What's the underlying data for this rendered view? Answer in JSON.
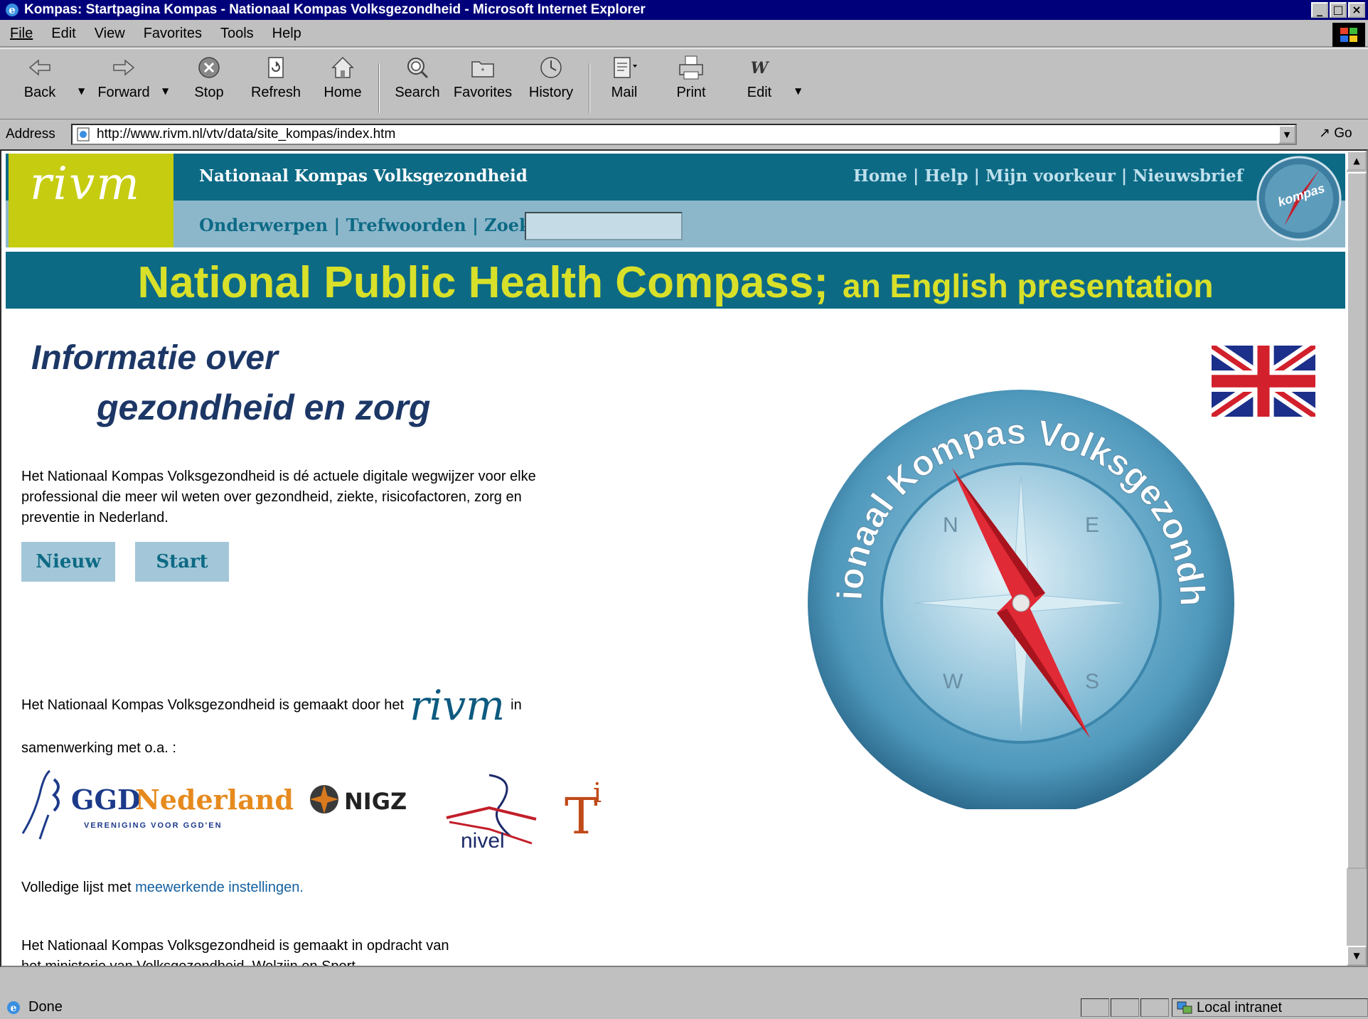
{
  "window": {
    "title": "Kompas: Startpagina Kompas - Nationaal Kompas Volksgezondheid - Microsoft Internet Explorer",
    "min": "_",
    "max": "□",
    "close": "×"
  },
  "menu": [
    "File",
    "Edit",
    "View",
    "Favorites",
    "Tools",
    "Help"
  ],
  "toolbar": {
    "back": "Back",
    "forward": "Forward",
    "stop": "Stop",
    "refresh": "Refresh",
    "home": "Home",
    "search": "Search",
    "favorites": "Favorites",
    "history": "History",
    "mail": "Mail",
    "print": "Print",
    "edit": "Edit"
  },
  "address": {
    "label": "Address",
    "url": "http://www.rivm.nl/vtv/data/site_kompas/index.htm",
    "go": "Go"
  },
  "site": {
    "logo": "rivm",
    "name": "Nationaal Kompas Volksgezondheid",
    "topnav": "Home | Help | Mijn voorkeur | Nieuwsbrief",
    "subnav": "Onderwerpen | Trefwoorden | Zoek :",
    "search_value": "",
    "kompas_logo": "kompas"
  },
  "banner": {
    "big": "National Public Health Compass;",
    "small": "an English presentation"
  },
  "heading": {
    "line1": "Informatie over",
    "line2": "gezondheid en zorg"
  },
  "intro": {
    "line1": "Het Nationaal Kompas Volksgezondheid is dé actuele digitale wegwijzer voor elke",
    "line2": "professional die meer wil weten over gezondheid, ziekte, risicofactoren, zorg en",
    "line3": "preventie in Nederland."
  },
  "buttons": {
    "nieuw": "Nieuw",
    "start": "Start"
  },
  "madeby": {
    "before": "Het Nationaal Kompas Volksgezondheid is gemaakt door het",
    "logo": "rivm",
    "after": "in",
    "line2": "samenwerking met o.a. :"
  },
  "partners": {
    "ggd": "GGD",
    "nederland": "Nederland",
    "ggd_sub": "VERENIGING VOOR GGD'EN",
    "nigz": "NIGZ",
    "nivel": "nivel",
    "t": "T",
    "i": "i"
  },
  "list": {
    "prefix": "Volledige lijst met",
    "link": "meewerkende instellingen."
  },
  "commission": {
    "line1": "Het Nationaal Kompas Volksgezondheid is gemaakt in opdracht van",
    "line2": "het ministerie van Volksgezondheid, Welzijn en Sport."
  },
  "compass": {
    "ring_text": "Nationaal Kompas Volksgezondheid",
    "n": "N",
    "e": "E",
    "s": "S",
    "w": "W"
  },
  "status": {
    "text": "Done",
    "zone": "Local intranet"
  },
  "colors": {
    "site_header": "#0d6a85",
    "subnav_bg": "#8cb7cb",
    "rivm_yellow": "#c6cc10",
    "banner_text": "#d8e02a",
    "heading": "#1c3766"
  }
}
